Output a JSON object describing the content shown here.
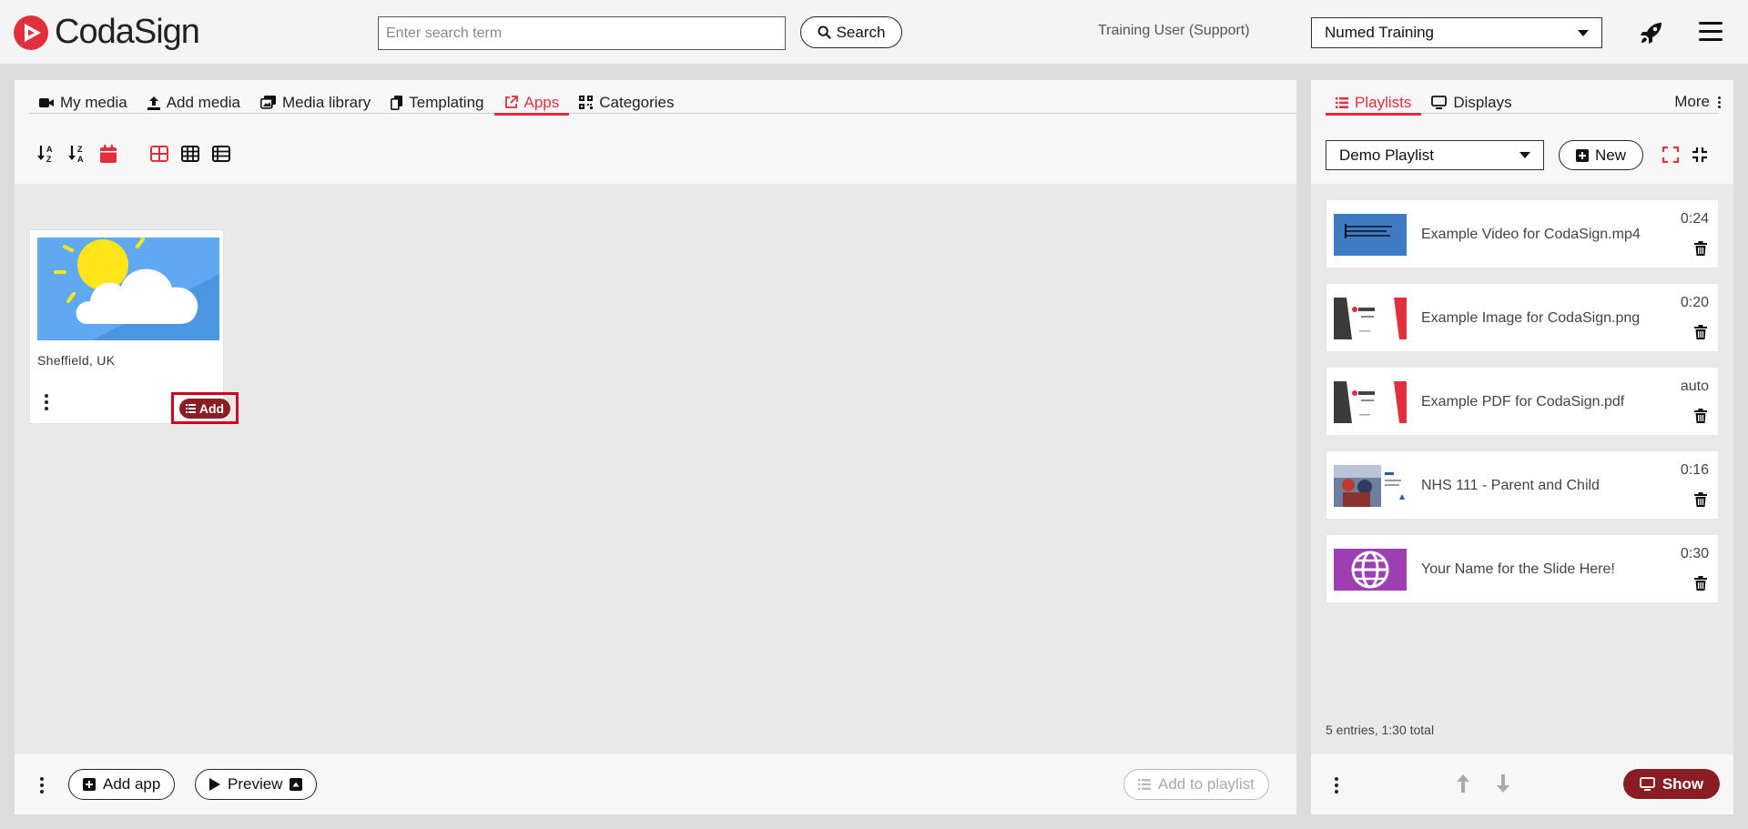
{
  "app": {
    "logo_text": "CodaSign",
    "brand_color": "#e0303c"
  },
  "header": {
    "search_placeholder": "Enter search term",
    "search_value": "",
    "search_button": "Search",
    "user_label": "Training User (Support)",
    "org_selected": "Numed Training"
  },
  "media_tabs": [
    {
      "label": "My media",
      "icon": "video-camera-icon",
      "active": false
    },
    {
      "label": "Add media",
      "icon": "upload-icon",
      "active": false
    },
    {
      "label": "Media library",
      "icon": "images-icon",
      "active": false
    },
    {
      "label": "Templating",
      "icon": "copy-icon",
      "active": false
    },
    {
      "label": "Apps",
      "icon": "external-link-icon",
      "active": true
    },
    {
      "label": "Categories",
      "icon": "qrcode-icon",
      "active": false
    }
  ],
  "app_card": {
    "title": "Sheffield, UK",
    "add_label": "Add"
  },
  "main_bottom": {
    "add_app_label": "Add app",
    "preview_label": "Preview",
    "add_to_playlist_label": "Add to playlist"
  },
  "side": {
    "tabs": [
      {
        "label": "Playlists",
        "active": true
      },
      {
        "label": "Displays",
        "active": false
      }
    ],
    "more_label": "More",
    "playlist_selected": "Demo Playlist",
    "new_label": "New",
    "entries": [
      {
        "name": "Example Video for CodaSign.mp4",
        "duration": "0:24",
        "thumb": "video"
      },
      {
        "name": "Example Image for CodaSign.png",
        "duration": "0:20",
        "thumb": "codasign"
      },
      {
        "name": "Example PDF for CodaSign.pdf",
        "duration": "auto",
        "thumb": "codasign"
      },
      {
        "name": "NHS 111 - Parent and Child",
        "duration": "0:16",
        "thumb": "nhs"
      },
      {
        "name": "Your Name for the Slide Here!",
        "duration": "0:30",
        "thumb": "globe"
      }
    ],
    "summary": "5 entries, 1:30 total",
    "show_label": "Show"
  }
}
